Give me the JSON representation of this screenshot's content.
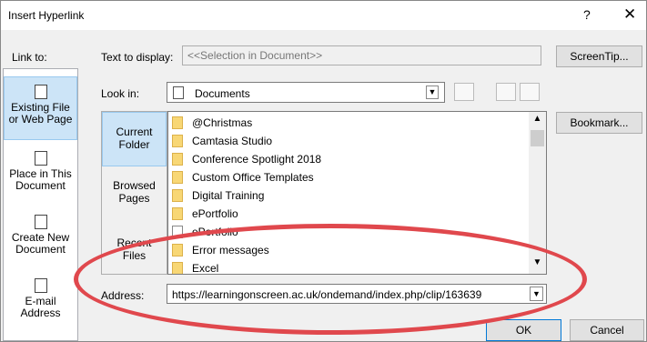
{
  "window": {
    "title": "Insert Hyperlink",
    "help": "?",
    "close": "✕"
  },
  "link_to": {
    "label": "Link to:",
    "items": [
      {
        "line1": "Existing File",
        "line2": "or Web Page",
        "selected": true
      },
      {
        "line1": "Place in This",
        "line2": "Document",
        "selected": false
      },
      {
        "line1": "Create New",
        "line2": "Document",
        "selected": false
      },
      {
        "line1": "E-mail",
        "line2": "Address",
        "selected": false
      }
    ]
  },
  "text_to_display": {
    "label": "Text to display:",
    "value": "<<Selection in Document>>"
  },
  "screentip_button": "ScreenTip...",
  "look_in": {
    "label": "Look in:",
    "value": "Documents"
  },
  "bookmark_button": "Bookmark...",
  "places": [
    {
      "line1": "Current",
      "line2": "Folder",
      "selected": true
    },
    {
      "line1": "Browsed",
      "line2": "Pages",
      "selected": false
    },
    {
      "line1": "Recent",
      "line2": "Files",
      "selected": false
    }
  ],
  "files": [
    "@Christmas",
    "Camtasia Studio",
    "Conference Spotlight 2018",
    "Custom Office Templates",
    "Digital Training",
    "ePortfolio",
    "ePortfolio",
    "Error messages",
    "Excel"
  ],
  "address": {
    "label": "Address:",
    "value": "https://learningonscreen.ac.uk/ondemand/index.php/clip/163639"
  },
  "ok_button": "OK",
  "cancel_button": "Cancel",
  "colors": {
    "annotation": "#e0484d",
    "selection": "#cce4f7"
  }
}
